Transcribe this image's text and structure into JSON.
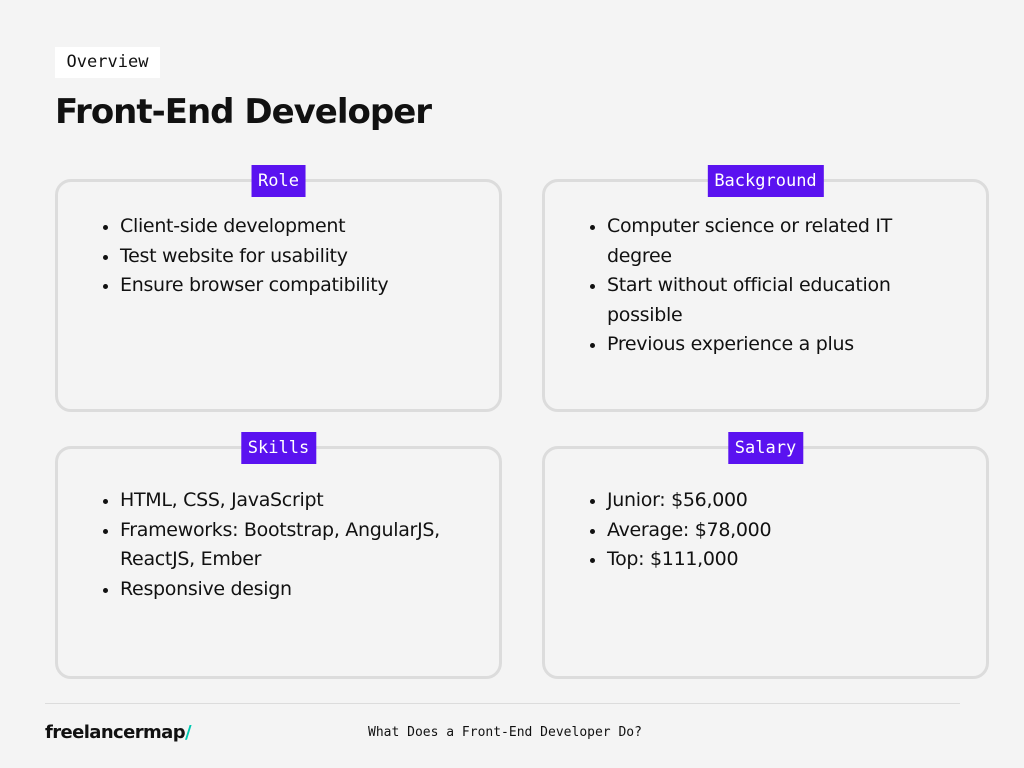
{
  "header": {
    "tag": "Overview",
    "title": "Front-End Developer"
  },
  "colors": {
    "accent": "#5a12f0",
    "brand_slash": "#00c9b1",
    "background": "#f4f4f4",
    "card_border": "#dcdcdc"
  },
  "cards": {
    "role": {
      "label": "Role",
      "items": [
        "Client-side development",
        "Test website for usability",
        "Ensure browser compatibility"
      ]
    },
    "background": {
      "label": "Background",
      "items": [
        "Computer science or related IT degree",
        "Start without official education possible",
        "Previous experience a plus"
      ]
    },
    "skills": {
      "label": "Skills",
      "items": [
        "HTML, CSS, JavaScript",
        "Frameworks: Bootstrap, AngularJS, ReactJS, Ember",
        "Responsive design"
      ]
    },
    "salary": {
      "label": "Salary",
      "items": [
        "Junior: $56,000",
        "Average: $78,000",
        "Top: $111,000"
      ]
    }
  },
  "footer": {
    "brand_name": "freelancermap",
    "brand_mark": "/",
    "caption": "What Does a Front-End Developer Do?"
  }
}
